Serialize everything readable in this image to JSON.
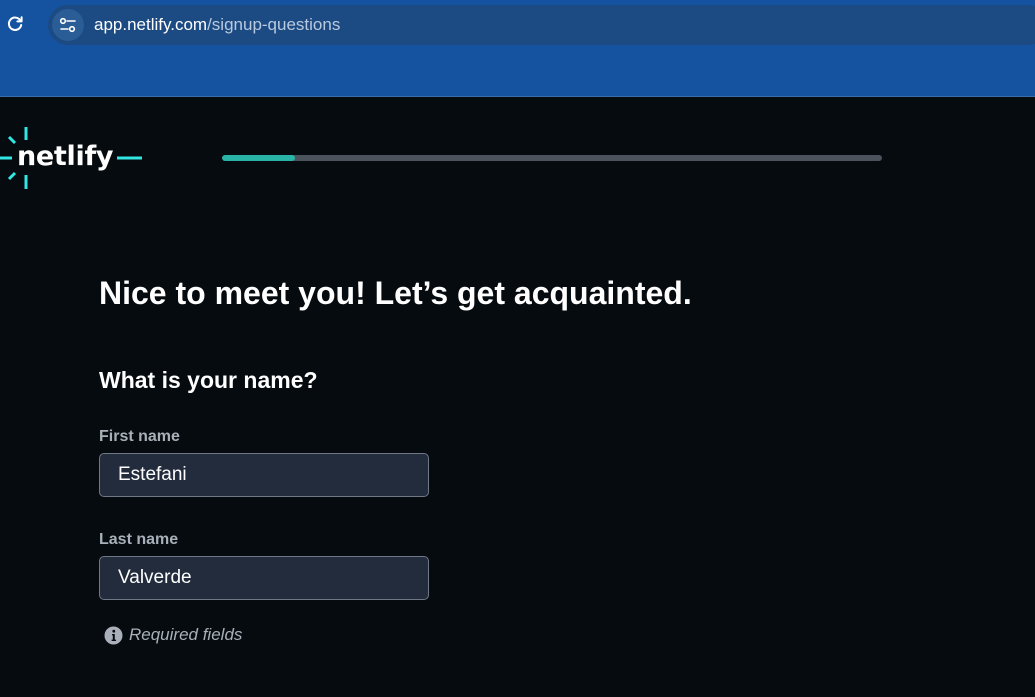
{
  "browser": {
    "url_host": "app.netlify.com",
    "url_path": "/signup-questions",
    "icons": {
      "reload": "reload-icon",
      "site_info": "tune-icon"
    }
  },
  "brand": {
    "logo_text": "netlify",
    "accent_color": "#32e6e2"
  },
  "progress": {
    "fraction": 0.11,
    "color": "#28b5a8"
  },
  "form": {
    "heading": "Nice to meet you! Let’s get acquainted.",
    "question": "What is your name?",
    "first_name": {
      "label": "First name",
      "value": "Estefani"
    },
    "last_name": {
      "label": "Last name",
      "value": "Valverde"
    },
    "required_note": "Required fields"
  }
}
